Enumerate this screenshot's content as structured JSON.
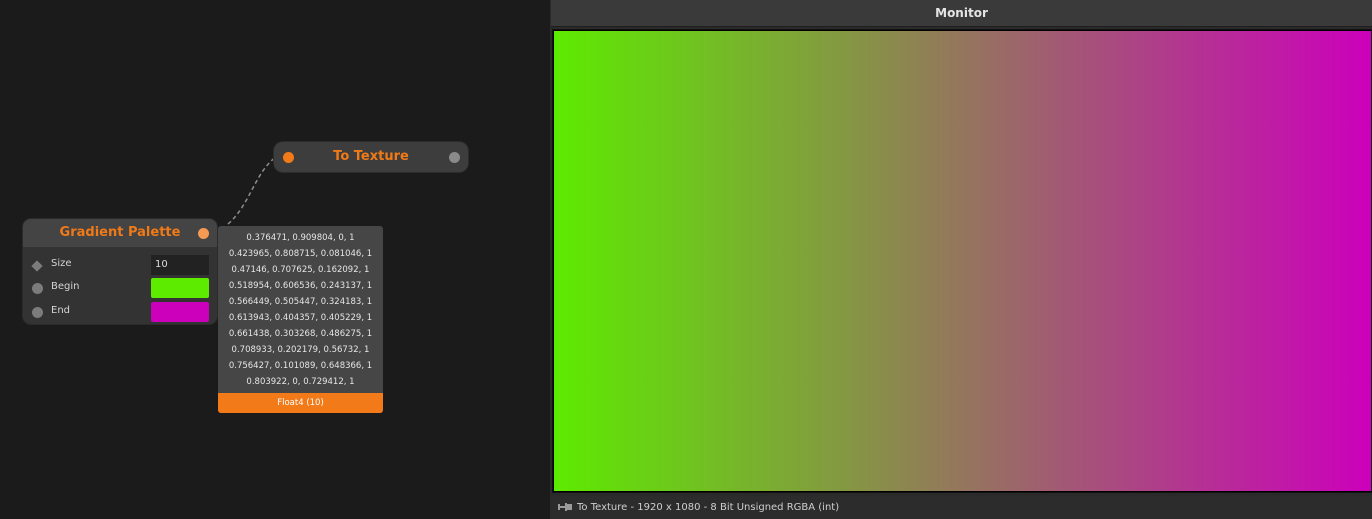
{
  "graph": {
    "to_texture": {
      "title": "To Texture"
    },
    "gradient_palette": {
      "title": "Gradient Palette",
      "params": [
        {
          "label": "Size",
          "value": "10",
          "icon": "diamond-icon"
        },
        {
          "label": "Begin",
          "color": "#5deb00",
          "icon": "circle-icon"
        },
        {
          "label": "End",
          "color": "#cc00bb",
          "icon": "circle-icon"
        }
      ]
    },
    "output_preview": {
      "values": [
        "0.376471, 0.909804, 0, 1",
        "0.423965, 0.808715, 0.081046, 1",
        "0.47146, 0.707625, 0.162092, 1",
        "0.518954, 0.606536, 0.243137, 1",
        "0.566449, 0.505447, 0.324183, 1",
        "0.613943, 0.404357, 0.405229, 1",
        "0.661438, 0.303268, 0.486275, 1",
        "0.708933, 0.202179, 0.56732, 1",
        "0.756427, 0.101089, 0.648366, 1",
        "0.803922, 0, 0.729412, 1"
      ],
      "type_label": "Float4 (10)"
    }
  },
  "monitor": {
    "title": "Monitor",
    "status": "To Texture - 1920 x 1080 - 8 Bit Unsigned RGBA (int)",
    "gradient_start": "#5deb00",
    "gradient_end": "#cc00bb"
  },
  "colors": {
    "accent": "#f37a18",
    "background": "#1b1b1b"
  }
}
